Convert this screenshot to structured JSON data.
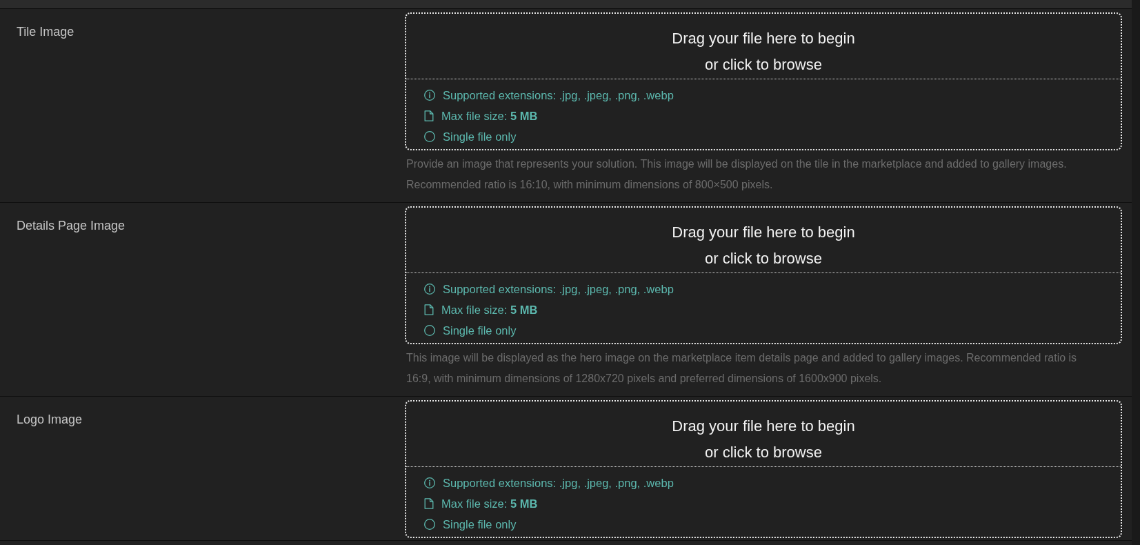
{
  "fields": [
    {
      "label": "Tile Image",
      "dropzone": {
        "prompt_lines": [
          "Drag your file here to begin",
          "or click to browse"
        ],
        "requirements": [
          {
            "kind": "info",
            "text": "Supported extensions: .jpg, .jpeg, .png, .webp"
          },
          {
            "kind": "file",
            "text": "Max file size: **5 MB**"
          },
          {
            "kind": "single",
            "text": "Single file only"
          }
        ]
      },
      "help_text": "Provide an image that represents your solution. This image will be displayed on the tile in the marketplace and added to gallery images. Recommended ratio is 16:10, with minimum dimensions of 800×500 pixels."
    },
    {
      "label": "Details Page Image",
      "dropzone": {
        "prompt_lines": [
          "Drag your file here to begin",
          "or click to browse"
        ],
        "requirements": [
          {
            "kind": "info",
            "text": "Supported extensions: .jpg, .jpeg, .png, .webp"
          },
          {
            "kind": "file",
            "text": "Max file size: **5 MB**"
          },
          {
            "kind": "single",
            "text": "Single file only"
          }
        ]
      },
      "help_text": "This image will be displayed as the hero image on the marketplace item details page and added to gallery images. Recommended ratio is 16:9, with minimum dimensions of 1280x720 pixels and preferred dimensions of 1600x900 pixels."
    },
    {
      "label": "Logo Image",
      "dropzone": {
        "prompt_lines": [
          "Drag your file here to begin",
          "or click to browse"
        ],
        "requirements": [
          {
            "kind": "info",
            "text": "Supported extensions: .jpg, .jpeg, .png, .webp"
          },
          {
            "kind": "file",
            "text": "Max file size: **5 MB**"
          },
          {
            "kind": "single",
            "text": "Single file only"
          }
        ]
      }
    }
  ]
}
